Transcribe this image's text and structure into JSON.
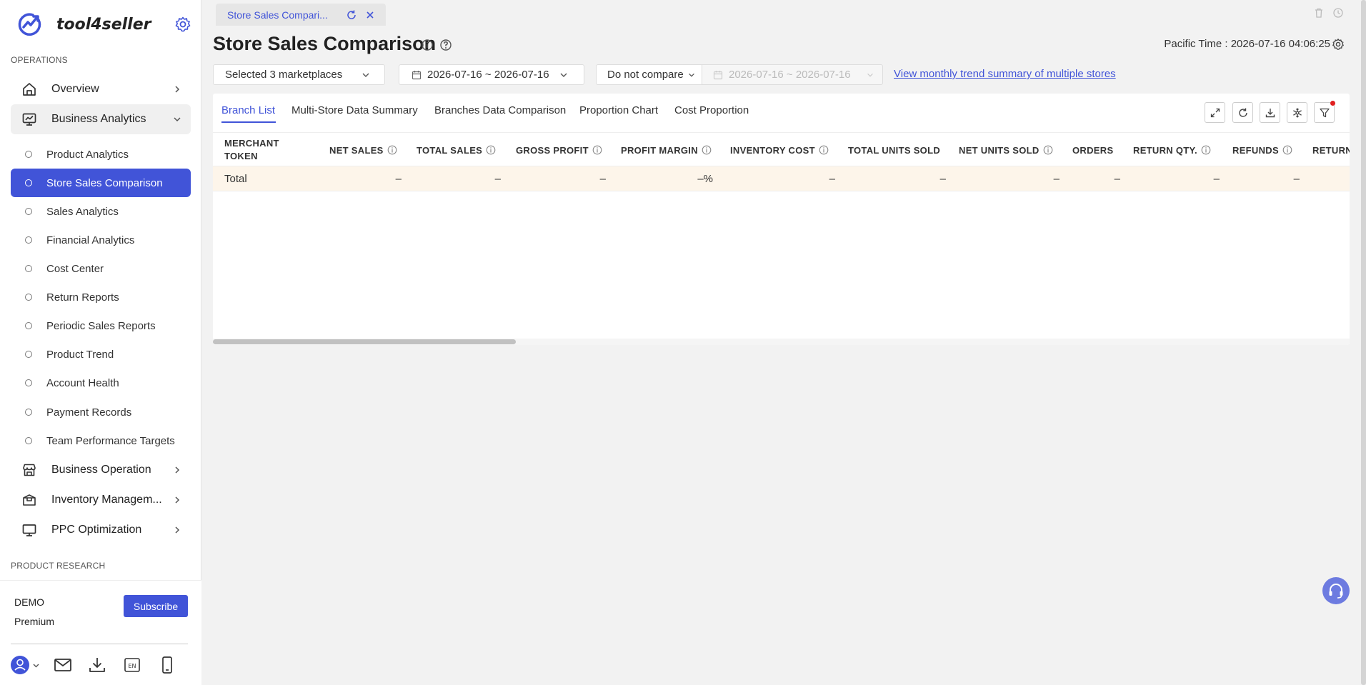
{
  "brand": {
    "name": "tool4seller",
    "logo_icon": "trend-logo-icon"
  },
  "sidebar": {
    "section_operations": "OPERATIONS",
    "section_product_research": "PRODUCT RESEARCH",
    "top_items": [
      {
        "label": "Overview",
        "icon": "home-icon"
      },
      {
        "label": "Business Analytics",
        "icon": "chart-monitor-icon",
        "expanded": true
      },
      {
        "label": "Business Operation",
        "icon": "store-icon"
      },
      {
        "label": "Inventory Managem...",
        "icon": "inventory-box-icon"
      },
      {
        "label": "PPC Optimization",
        "icon": "monitor-icon"
      }
    ],
    "sub_items": [
      {
        "label": "Product Analytics"
      },
      {
        "label": "Store Sales Comparison",
        "active": true
      },
      {
        "label": "Sales Analytics"
      },
      {
        "label": "Financial Analytics"
      },
      {
        "label": "Cost Center"
      },
      {
        "label": "Return Reports"
      },
      {
        "label": "Periodic Sales Reports"
      },
      {
        "label": "Product Trend"
      },
      {
        "label": "Account Health"
      },
      {
        "label": "Payment Records"
      },
      {
        "label": "Team Performance Targets"
      }
    ],
    "footer": {
      "plan_name": "DEMO",
      "plan_tier": "Premium",
      "subscribe_label": "Subscribe",
      "icons": [
        "user-avatar-icon",
        "mail-icon",
        "download-icon",
        "language-en-icon",
        "mobile-icon"
      ]
    }
  },
  "tabbar": {
    "tab_label": "Store Sales Compari..."
  },
  "header": {
    "title": "Store Sales Comparison",
    "pacific_time": "Pacific Time :  2026-07-16 04:06:25"
  },
  "filters": {
    "marketplaces": "Selected 3 marketplaces",
    "date_range": "2026-07-16 ~ 2026-07-16",
    "compare": "Do not compare",
    "compare_date_range": "2026-07-16 ~ 2026-07-16",
    "trend_link": "View monthly trend summary of multiple stores"
  },
  "subtabs": [
    "Branch List",
    "Multi-Store Data Summary",
    "Branches Data Comparison",
    "Proportion Chart",
    "Cost Proportion"
  ],
  "table": {
    "columns": [
      {
        "label": "MERCHANT TOKEN",
        "info": false
      },
      {
        "label": "NET SALES",
        "info": true
      },
      {
        "label": "TOTAL SALES",
        "info": true
      },
      {
        "label": "GROSS PROFIT",
        "info": true
      },
      {
        "label": "PROFIT MARGIN",
        "info": true
      },
      {
        "label": "INVENTORY COST",
        "info": true
      },
      {
        "label": "TOTAL UNITS SOLD",
        "info": false
      },
      {
        "label": "NET UNITS SOLD",
        "info": true
      },
      {
        "label": "ORDERS",
        "info": false
      },
      {
        "label": "RETURN QTY.",
        "info": true
      },
      {
        "label": "REFUNDS",
        "info": true
      },
      {
        "label": "RETURN",
        "info": false
      }
    ],
    "total_row": [
      "Total",
      "–",
      "–",
      "–",
      "–%",
      "–",
      "–",
      "–",
      "–",
      "–",
      "–",
      ""
    ]
  },
  "colors": {
    "accent": "#4154d8",
    "total_row_bg": "#fdf5ea",
    "notification": "#e02020"
  }
}
